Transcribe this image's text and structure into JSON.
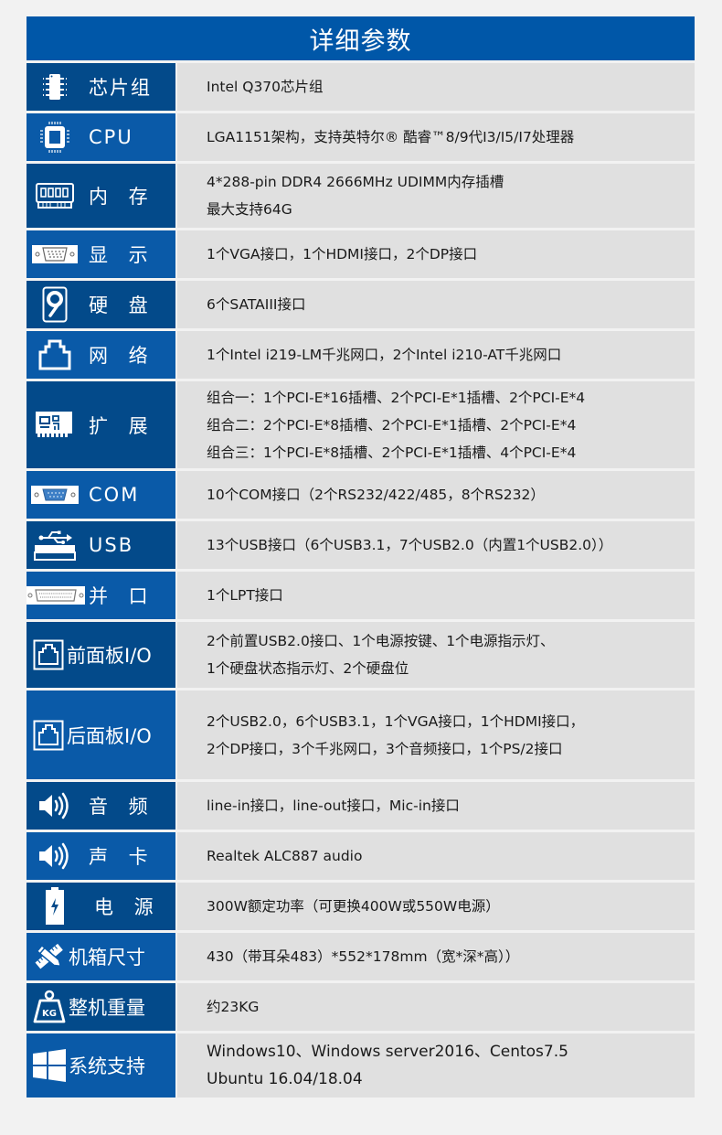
{
  "title": "详细参数",
  "colors": {
    "title_bg": "#0057a8",
    "label_dark": "#034a8a",
    "label_light": "#0a5aa8",
    "value_bg": "#e0e0e0",
    "page_bg": "#f2f2f2"
  },
  "rows": [
    {
      "label": "芯片组",
      "icon": "chip-icon",
      "lines": [
        "Intel Q370芯片组"
      ]
    },
    {
      "label": "CPU",
      "icon": "cpu-icon",
      "lines": [
        "LGA1151架构，支持英特尔® 酷睿™8/9代I3/I5/I7处理器"
      ]
    },
    {
      "label": "内 存",
      "icon": "memory-icon",
      "lines": [
        "4*288-pin DDR4 2666MHz  UDIMM内存插槽",
        "最大支持64G"
      ]
    },
    {
      "label": "显 示",
      "icon": "vga-port-icon",
      "lines": [
        "1个VGA接口，1个HDMI接口，2个DP接口"
      ]
    },
    {
      "label": "硬 盘",
      "icon": "hard-disk-icon",
      "lines": [
        "6个SATAIII接口"
      ]
    },
    {
      "label": "网 络",
      "icon": "ethernet-port-icon",
      "lines": [
        "1个Intel i219-LM千兆网口，2个Intel i210-AT千兆网口"
      ]
    },
    {
      "label": "扩 展",
      "icon": "expansion-card-icon",
      "lines": [
        "组合一：1个PCI-E*16插槽、2个PCI-E*1插槽、2个PCI-E*4",
        "组合二：2个PCI-E*8插槽、2个PCI-E*1插槽、2个PCI-E*4",
        "组合三：1个PCI-E*8插槽、2个PCI-E*1插槽、4个PCI-E*4"
      ]
    },
    {
      "label": "COM",
      "icon": "serial-port-icon",
      "lines": [
        "10个COM接口（2个RS232/422/485，8个RS232）"
      ]
    },
    {
      "label": "USB",
      "icon": "usb-icon",
      "lines": [
        "13个USB接口（6个USB3.1，7个USB2.0（内置1个USB2.0））"
      ]
    },
    {
      "label": "并 口",
      "icon": "parallel-port-icon",
      "lines": [
        "1个LPT接口"
      ]
    },
    {
      "label": "前面板I/O",
      "icon": "front-panel-port-icon",
      "lines": [
        "2个前置USB2.0接口、1个电源按键、1个电源指示灯、",
        "1个硬盘状态指示灯、2个硬盘位"
      ]
    },
    {
      "label": "后面板I/O",
      "icon": "rear-panel-port-icon",
      "lines": [
        "2个USB2.0，6个USB3.1，1个VGA接口，1个HDMI接口，",
        "2个DP接口，3个千兆网口，3个音频接口，1个PS/2接口"
      ]
    },
    {
      "label": "音 频",
      "icon": "speaker-icon",
      "lines": [
        "line-in接口，line-out接口，Mic-in接口"
      ]
    },
    {
      "label": "声 卡",
      "icon": "speaker-icon",
      "lines": [
        "Realtek  ALC887 audio"
      ]
    },
    {
      "label": "电 源",
      "icon": "battery-icon",
      "lines": [
        "300W额定功率（可更换400W或550W电源）"
      ]
    },
    {
      "label": "机箱尺寸",
      "icon": "ruler-pencil-icon",
      "lines": [
        "430（带耳朵483）*552*178mm（宽*深*高））"
      ]
    },
    {
      "label": "整机重量",
      "icon": "weight-kg-icon",
      "lines": [
        "约23KG"
      ]
    },
    {
      "label": "系统支持",
      "icon": "windows-logo-icon",
      "lines": [
        "Windows10、Windows server2016、Centos7.5",
        "Ubuntu 16.04/18.04"
      ]
    }
  ]
}
